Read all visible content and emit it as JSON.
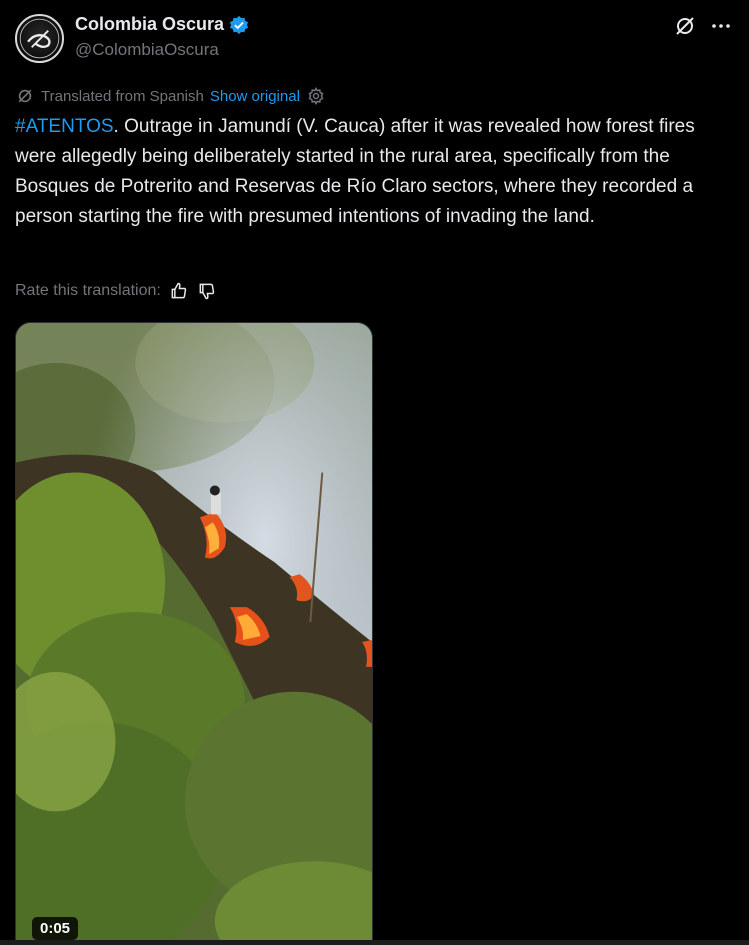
{
  "author": {
    "display_name": "Colombia Oscura",
    "handle": "@ColombiaOscura",
    "verified_color": "#1d9bf0"
  },
  "translation": {
    "note": "Translated from Spanish",
    "show_original_label": "Show original",
    "rate_label": "Rate this translation:"
  },
  "tweet": {
    "hashtag": "#ATENTOS",
    "body": ". Outrage in Jamundí (V. Cauca) after it was revealed how forest fires were allegedly being deliberately started in the rural area, specifically from the Bosques de Potrerito and Reservas de Río Claro sectors, where they recorded a person starting the fire with presumed intentions of invading the land."
  },
  "media": {
    "duration": "0:05"
  },
  "icons": {
    "grok": "grok-icon",
    "more": "more-icon",
    "translate": "translate-icon",
    "settings": "gear-icon",
    "thumbs_up": "thumbs-up-icon",
    "thumbs_down": "thumbs-down-icon"
  },
  "colors": {
    "background": "#000000",
    "text": "#e7e9ea",
    "muted": "#71767b",
    "link": "#1d9bf0"
  }
}
